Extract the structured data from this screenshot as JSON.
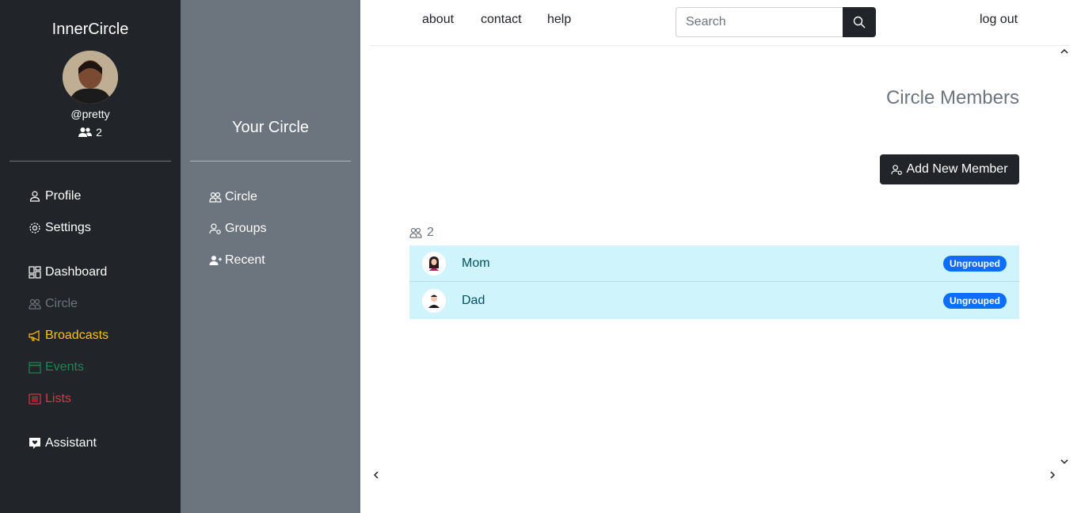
{
  "sidebar": {
    "brand": "InnerCircle",
    "handle": "@pretty",
    "count": "2",
    "items": [
      {
        "label": "Profile",
        "color": "#ffffff"
      },
      {
        "label": "Settings",
        "color": "#ffffff"
      },
      {
        "label": "Dashboard",
        "color": "#ffffff"
      },
      {
        "label": "Circle",
        "color": "#6c757d"
      },
      {
        "label": "Broadcasts",
        "color": "#ffc107"
      },
      {
        "label": "Events",
        "color": "#198754"
      },
      {
        "label": "Lists",
        "color": "#dc3545"
      },
      {
        "label": "Assistant",
        "color": "#ffffff"
      }
    ]
  },
  "circle_nav": {
    "title": "Your Circle",
    "items": [
      {
        "label": "Circle"
      },
      {
        "label": "Groups"
      },
      {
        "label": "Recent"
      }
    ]
  },
  "topnav": {
    "links": [
      "about",
      "contact",
      "help"
    ],
    "search_placeholder": "Search",
    "logout": "log out"
  },
  "main": {
    "title": "Circle Members",
    "add_button": "Add New Member",
    "member_count": "2",
    "members": [
      {
        "name": "Mom",
        "badge": "Ungrouped"
      },
      {
        "name": "Dad",
        "badge": "Ungrouped"
      }
    ]
  }
}
